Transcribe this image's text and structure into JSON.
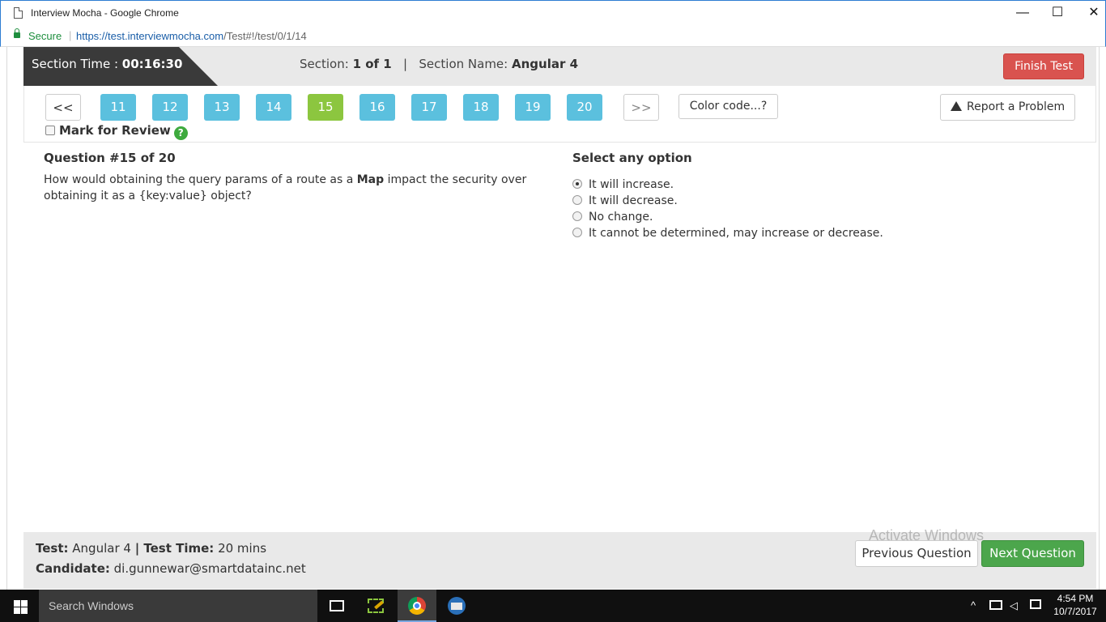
{
  "window": {
    "title": "Interview Mocha - Google Chrome",
    "controls": [
      "—",
      "☐",
      "✕"
    ]
  },
  "address_bar": {
    "secure_label": "Secure",
    "url_prefix": "https://",
    "url_host": "test.interviewmocha.com",
    "url_path": "/Test#!/test/0/1/14"
  },
  "section": {
    "time_label": "Section Time : ",
    "time_value": "00:16:30",
    "section_label": "Section: ",
    "section_value": "1 of 1",
    "separator": "|",
    "name_label": "Section Name: ",
    "name_value": "Angular 4",
    "finish_button": "Finish Test"
  },
  "navigation": {
    "prev": "<<",
    "next": ">>",
    "questions": [
      "11",
      "12",
      "13",
      "14",
      "15",
      "16",
      "17",
      "18",
      "19",
      "20"
    ],
    "current": "15",
    "color_code_button": "Color code...?",
    "report_button": "Report a Problem",
    "mark_review_label": "Mark for Review",
    "help_icon": "?"
  },
  "question": {
    "heading": "Question #15 of 20",
    "text_before": "How would obtaining the query params of a route as a ",
    "text_bold": "Map",
    "text_after": " impact the security over obtaining it as a {key:value} object?"
  },
  "answers": {
    "heading": "Select any option",
    "options": [
      "It will increase.",
      "It will decrease.",
      "No change.",
      "It cannot be determined, may increase or decrease."
    ],
    "selected_index": 0
  },
  "footer": {
    "test_label": "Test:",
    "test_value": " Angular 4 ",
    "sep": "|",
    "time_label": " Test Time:",
    "time_value": " 20 mins",
    "candidate_label": "Candidate:",
    "candidate_value": " di.gunnewar@smartdatainc.net",
    "prev_button": "Previous Question",
    "next_button": "Next Question"
  },
  "watermark": {
    "line1": "Activate Windows"
  },
  "taskbar": {
    "search_placeholder": "Search Windows",
    "time": "4:54 PM",
    "date": "10/7/2017"
  },
  "colors": {
    "question_default": "#5bc0de",
    "question_current": "#8cc63f",
    "finish": "#d9534f",
    "next": "#4ca64c"
  }
}
